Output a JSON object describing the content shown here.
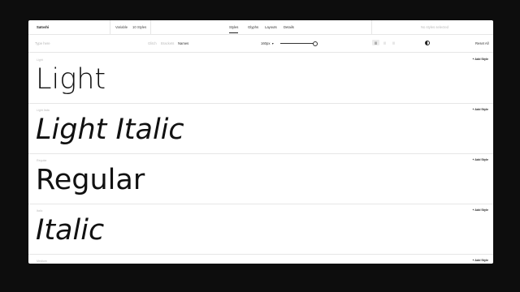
{
  "header": {
    "brand": "Satoshi",
    "variant_label": "Variable",
    "styles_count": "10 Styles",
    "tabs": [
      {
        "label": "Styles",
        "active": true
      },
      {
        "label": "Glyphs",
        "active": false
      },
      {
        "label": "Layouts",
        "active": false
      },
      {
        "label": "Details",
        "active": false
      }
    ],
    "selection_status": "No styles selected"
  },
  "toolbar": {
    "preview_placeholder": "Type here",
    "modes": [
      "Glitch",
      "Brackets",
      "Names"
    ],
    "active_mode": "Names",
    "size_value": "160px",
    "size_slider_level": 1.0,
    "align_buttons": [
      "left",
      "center",
      "right"
    ],
    "align_labels": [
      "|||",
      "|||",
      "|||"
    ],
    "active_align": "left",
    "theme_toggle_icon": "half-circle-icon",
    "reset_label": "Reset All"
  },
  "rows": [
    {
      "label": "Light",
      "preview": "Light",
      "add_label": "+ Add Style"
    },
    {
      "label": "Light Italic",
      "preview": "Light Italic",
      "add_label": "+ Add Style"
    },
    {
      "label": "Regular",
      "preview": "Regular",
      "add_label": "+ Add Style"
    },
    {
      "label": "Italic",
      "preview": "Italic",
      "add_label": "+ Add Style"
    },
    {
      "label": "Medium",
      "preview": "",
      "add_label": "+ Add Style"
    }
  ],
  "colors": {
    "background": "#0d0d0d",
    "panel": "#ffffff",
    "text": "#111111",
    "muted": "#bbbbbb",
    "divider": "#e6e6e6"
  }
}
